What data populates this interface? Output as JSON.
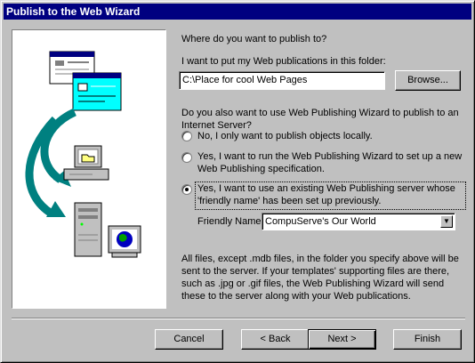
{
  "window": {
    "title": "Publish to the Web Wizard"
  },
  "question": "Where do you want to publish to?",
  "folder": {
    "label": "I want to put my Web publications in this folder:",
    "value": "C:\\Place for cool Web Pages",
    "browse_label": "Browse..."
  },
  "server_question": "Do you also want to use Web Publishing Wizard to publish to an Internet Server?",
  "options": [
    {
      "label": "No, I only want to publish objects locally.",
      "selected": false
    },
    {
      "label": "Yes, I want to run the Web Publishing Wizard to set up a new Web Publishing specification.",
      "selected": false
    },
    {
      "label": "Yes, I want to use an existing Web Publishing server whose 'friendly name' has been set up previously.",
      "selected": true
    }
  ],
  "friendly_name": {
    "label": "Friendly Name",
    "value": "CompuServe's Our World"
  },
  "info": "All files, except .mdb files, in the folder you specify above will be sent to the server. If your templates' supporting files are there, such as .jpg or .gif files, the Web Publishing Wizard will send these to the server along with your Web publications.",
  "buttons": {
    "cancel": "Cancel",
    "back": "< Back",
    "next": "Next >",
    "finish": "Finish"
  },
  "icons": [
    "web-pages-icon",
    "curved-arrow-icon",
    "folder-computer-icon",
    "server-tower-icon",
    "globe-monitor-icon"
  ],
  "colors": {
    "titlebar": "#000080",
    "face": "#c0c0c0",
    "arrow": "#008080"
  }
}
